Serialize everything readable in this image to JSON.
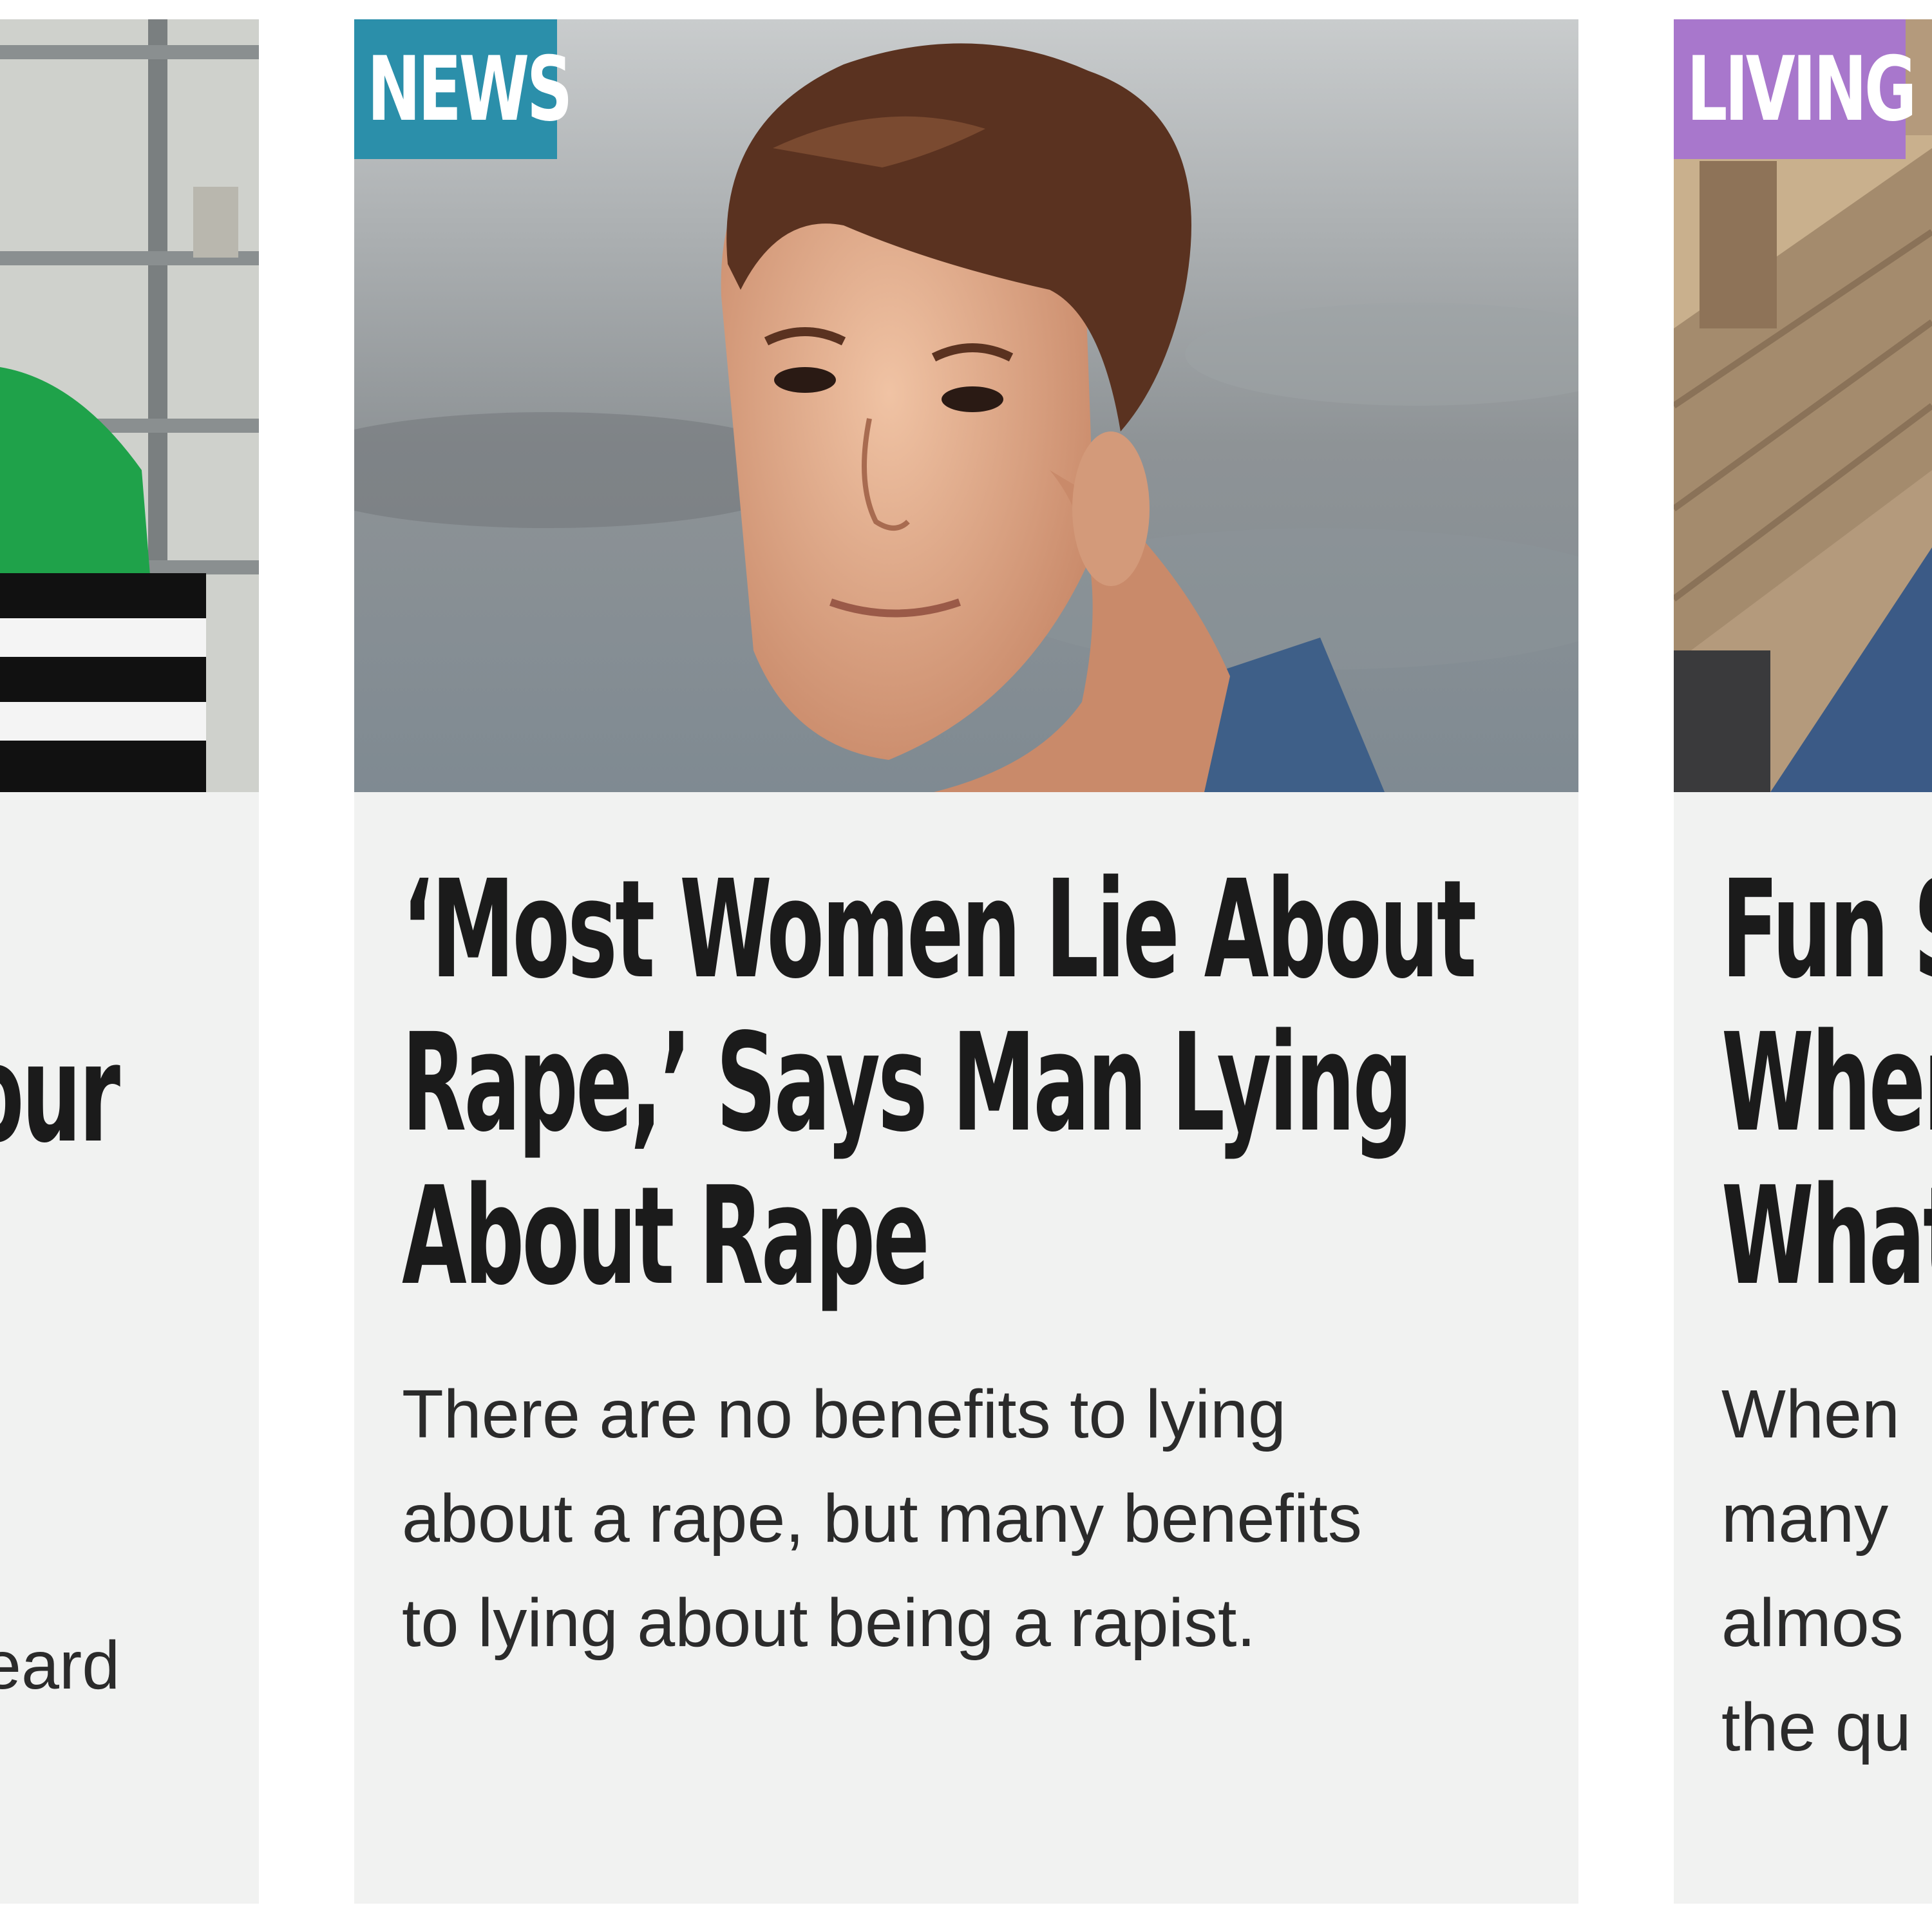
{
  "cards": {
    "left": {
      "headline_fragment": "our",
      "dek_fragment": "eard"
    },
    "middle": {
      "category": "NEWS",
      "category_color": "#2b8faa",
      "headline_lines": [
        "‘Most Women Lie About",
        "Rape,’ Says Man Lying",
        "About Rape"
      ],
      "dek_lines": [
        "There are no benefits to lying",
        "about a rape, but many benefits",
        "to lying about being a rapist."
      ]
    },
    "right": {
      "category": "LIVING",
      "category_color": "#a877cc",
      "headline_lines": [
        "Fun S",
        "When",
        "What"
      ],
      "dek_lines": [
        "When",
        "many",
        "almos",
        "the qu"
      ]
    }
  }
}
